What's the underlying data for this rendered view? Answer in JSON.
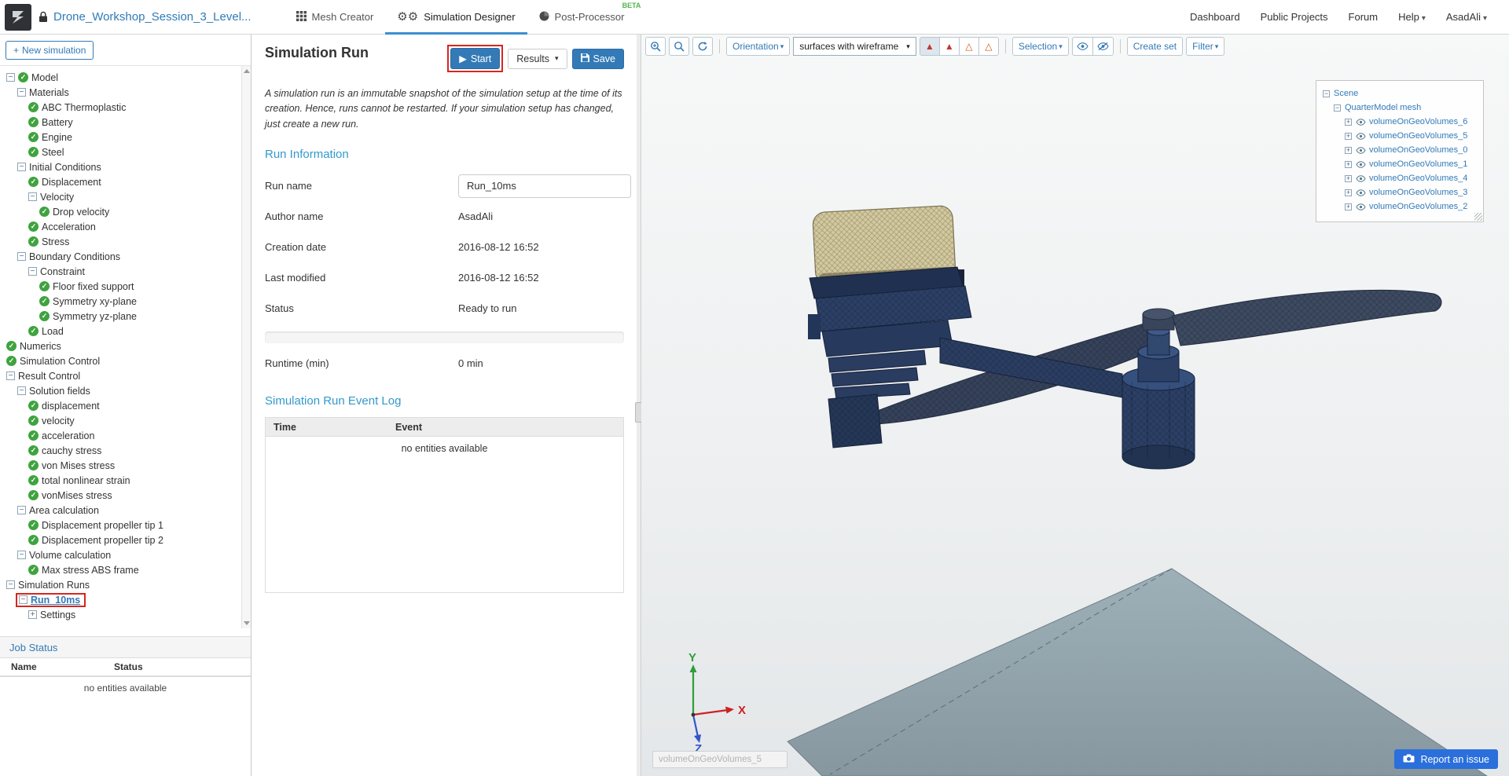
{
  "header": {
    "project_title": "Drone_Workshop_Session_3_Level...",
    "tabs": [
      {
        "label": "Mesh Creator"
      },
      {
        "label": "Simulation Designer"
      },
      {
        "label": "Post-Processor",
        "badge": "BETA"
      }
    ],
    "nav": [
      {
        "label": "Dashboard"
      },
      {
        "label": "Public Projects"
      },
      {
        "label": "Forum"
      },
      {
        "label": "Help",
        "caret": true
      },
      {
        "label": "AsadAli",
        "caret": true
      }
    ]
  },
  "sidebar": {
    "new_simulation_label": "New simulation",
    "tree": [
      {
        "label": "Model",
        "depth": 1,
        "icons": [
          "minus",
          "check"
        ]
      },
      {
        "label": "Materials",
        "depth": 2,
        "icons": [
          "minus"
        ]
      },
      {
        "label": "ABC Thermoplastic",
        "depth": 3,
        "icons": [
          "check"
        ]
      },
      {
        "label": "Battery",
        "depth": 3,
        "icons": [
          "check"
        ]
      },
      {
        "label": "Engine",
        "depth": 3,
        "icons": [
          "check"
        ]
      },
      {
        "label": "Steel",
        "depth": 3,
        "icons": [
          "check"
        ]
      },
      {
        "label": "Initial Conditions",
        "depth": 2,
        "icons": [
          "minus"
        ]
      },
      {
        "label": "Displacement",
        "depth": 3,
        "icons": [
          "check"
        ]
      },
      {
        "label": "Velocity",
        "depth": 3,
        "icons": [
          "minus"
        ]
      },
      {
        "label": "Drop velocity",
        "depth": 4,
        "icons": [
          "check"
        ]
      },
      {
        "label": "Acceleration",
        "depth": 3,
        "icons": [
          "check"
        ]
      },
      {
        "label": "Stress",
        "depth": 3,
        "icons": [
          "check"
        ]
      },
      {
        "label": "Boundary Conditions",
        "depth": 2,
        "icons": [
          "minus"
        ]
      },
      {
        "label": "Constraint",
        "depth": 3,
        "icons": [
          "minus"
        ]
      },
      {
        "label": "Floor fixed support",
        "depth": 4,
        "icons": [
          "check"
        ]
      },
      {
        "label": "Symmetry xy-plane",
        "depth": 4,
        "icons": [
          "check"
        ]
      },
      {
        "label": "Symmetry yz-plane",
        "depth": 4,
        "icons": [
          "check"
        ]
      },
      {
        "label": "Load",
        "depth": 3,
        "icons": [
          "check"
        ]
      },
      {
        "label": "Numerics",
        "depth": 1,
        "icons": [
          "check"
        ]
      },
      {
        "label": "Simulation Control",
        "depth": 1,
        "icons": [
          "check"
        ]
      },
      {
        "label": "Result Control",
        "depth": 1,
        "icons": [
          "minus"
        ]
      },
      {
        "label": "Solution fields",
        "depth": 2,
        "icons": [
          "minus"
        ]
      },
      {
        "label": "displacement",
        "depth": 3,
        "icons": [
          "check"
        ]
      },
      {
        "label": "velocity",
        "depth": 3,
        "icons": [
          "check"
        ]
      },
      {
        "label": "acceleration",
        "depth": 3,
        "icons": [
          "check"
        ]
      },
      {
        "label": "cauchy stress",
        "depth": 3,
        "icons": [
          "check"
        ]
      },
      {
        "label": "von Mises stress",
        "depth": 3,
        "icons": [
          "check"
        ]
      },
      {
        "label": "total nonlinear strain",
        "depth": 3,
        "icons": [
          "check"
        ]
      },
      {
        "label": "vonMises stress",
        "depth": 3,
        "icons": [
          "check"
        ]
      },
      {
        "label": "Area calculation",
        "depth": 2,
        "icons": [
          "minus"
        ]
      },
      {
        "label": "Displacement propeller tip 1",
        "depth": 3,
        "icons": [
          "check"
        ]
      },
      {
        "label": "Displacement propeller tip 2",
        "depth": 3,
        "icons": [
          "check"
        ]
      },
      {
        "label": "Volume calculation",
        "depth": 2,
        "icons": [
          "minus"
        ]
      },
      {
        "label": "Max stress ABS frame",
        "depth": 3,
        "icons": [
          "check"
        ]
      },
      {
        "label": "Simulation Runs",
        "depth": 1,
        "icons": [
          "minus"
        ]
      },
      {
        "label": "Run_10ms",
        "depth": 2,
        "icons": [
          "minus"
        ],
        "highlight": true
      },
      {
        "label": "Settings",
        "depth": 3,
        "icons": [
          "plus"
        ]
      }
    ],
    "job_status": {
      "title": "Job Status",
      "columns": [
        "Name",
        "Status"
      ],
      "empty_text": "no entities available"
    }
  },
  "main": {
    "title": "Simulation Run",
    "toolbar": {
      "start": "Start",
      "results": "Results",
      "save": "Save"
    },
    "description": "A simulation run is an immutable snapshot of the simulation setup at the time of its creation. Hence, runs cannot be restarted. If your simulation setup has changed, just create a new run.",
    "run_info": {
      "heading": "Run Information",
      "fields": [
        {
          "label": "Run name",
          "value": "Run_10ms",
          "input": true
        },
        {
          "label": "Author name",
          "value": "AsadAli"
        },
        {
          "label": "Creation date",
          "value": "2016-08-12 16:52"
        },
        {
          "label": "Last modified",
          "value": "2016-08-12 16:52"
        },
        {
          "label": "Status",
          "value": "Ready to run"
        }
      ],
      "progress_percent": 0,
      "runtime_label": "Runtime (min)",
      "runtime_value": "0 min"
    },
    "event_log": {
      "heading": "Simulation Run Event Log",
      "columns": [
        "Time",
        "Event"
      ],
      "empty_text": "no entities available"
    }
  },
  "viewport": {
    "toolbar": {
      "orientation": "Orientation",
      "render_mode": "surfaces with wireframe",
      "selection": "Selection",
      "create_set": "Create set",
      "filter": "Filter"
    },
    "scene_tree": {
      "root": "Scene",
      "mesh": "QuarterModel mesh",
      "volumes": [
        "volumeOnGeoVolumes_6",
        "volumeOnGeoVolumes_5",
        "volumeOnGeoVolumes_0",
        "volumeOnGeoVolumes_1",
        "volumeOnGeoVolumes_4",
        "volumeOnGeoVolumes_3",
        "volumeOnGeoVolumes_2"
      ]
    },
    "axes": {
      "x": "X",
      "y": "Y",
      "z": "Z"
    },
    "tooltip": "volumeOnGeoVolumes_5",
    "report_button": "Report an issue"
  },
  "colors": {
    "accent_blue": "#337ab7",
    "heading_blue": "#3399cc",
    "success_green": "#3fa33f",
    "annotation_red": "#d9261c"
  }
}
